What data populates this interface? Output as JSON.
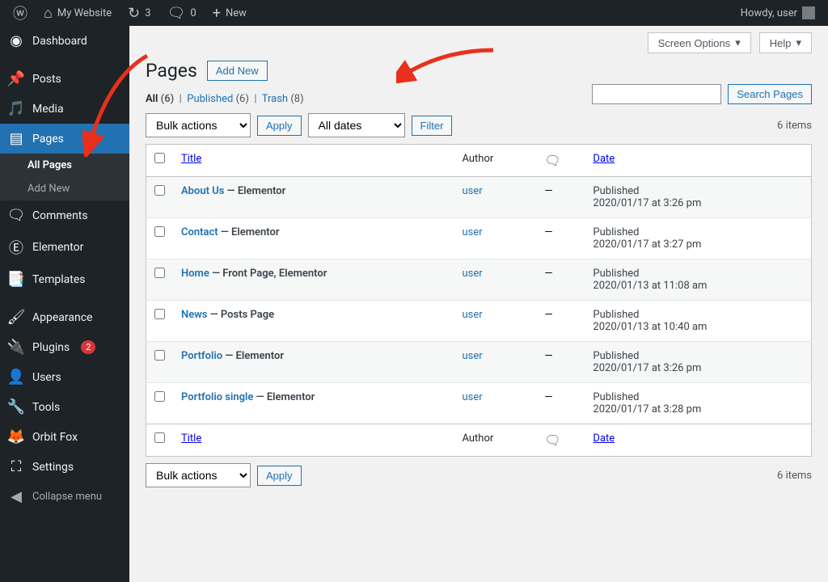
{
  "adminbar": {
    "site_name": "My Website",
    "updates_count": "3",
    "comments_count": "0",
    "new_label": "New",
    "howdy": "Howdy, user"
  },
  "sidebar": {
    "items": [
      {
        "label": "Dashboard",
        "icon": "dashboard"
      },
      {
        "label": "Posts",
        "icon": "pin"
      },
      {
        "label": "Media",
        "icon": "media"
      },
      {
        "label": "Pages",
        "icon": "pages",
        "current": true
      },
      {
        "label": "Comments",
        "icon": "comment"
      },
      {
        "label": "Elementor",
        "icon": "elementor"
      },
      {
        "label": "Templates",
        "icon": "templates"
      },
      {
        "label": "Appearance",
        "icon": "brush"
      },
      {
        "label": "Plugins",
        "icon": "plugin",
        "badge": "2"
      },
      {
        "label": "Users",
        "icon": "user"
      },
      {
        "label": "Tools",
        "icon": "wrench"
      },
      {
        "label": "Orbit Fox",
        "icon": "orbitfox"
      },
      {
        "label": "Settings",
        "icon": "settings"
      }
    ],
    "submenu": [
      {
        "label": "All Pages",
        "current": true
      },
      {
        "label": "Add New"
      }
    ],
    "collapse": "Collapse menu"
  },
  "header": {
    "screen_options": "Screen Options",
    "help": "Help",
    "page_title": "Pages",
    "add_new": "Add New"
  },
  "filters": {
    "all_label": "All",
    "all_count": "(6)",
    "published_label": "Published",
    "published_count": "(6)",
    "trash_label": "Trash",
    "trash_count": "(8)"
  },
  "search": {
    "button": "Search Pages"
  },
  "tablenav": {
    "bulk_label": "Bulk actions",
    "apply": "Apply",
    "dates_label": "All dates",
    "filter": "Filter",
    "item_count": "6 items"
  },
  "table": {
    "col_title": "Title",
    "col_author": "Author",
    "col_date": "Date",
    "rows": [
      {
        "title": "About Us",
        "state": "— Elementor",
        "author": "user",
        "comments": "—",
        "date_status": "Published",
        "date": "2020/01/17 at 3:26 pm"
      },
      {
        "title": "Contact",
        "state": "— Elementor",
        "author": "user",
        "comments": "—",
        "date_status": "Published",
        "date": "2020/01/17 at 3:27 pm"
      },
      {
        "title": "Home",
        "state": "— Front Page, Elementor",
        "author": "user",
        "comments": "—",
        "date_status": "Published",
        "date": "2020/01/13 at 11:08 am"
      },
      {
        "title": "News",
        "state": "— Posts Page",
        "author": "user",
        "comments": "—",
        "date_status": "Published",
        "date": "2020/01/13 at 10:40 am"
      },
      {
        "title": "Portfolio",
        "state": "— Elementor",
        "author": "user",
        "comments": "—",
        "date_status": "Published",
        "date": "2020/01/17 at 3:26 pm"
      },
      {
        "title": "Portfolio single",
        "state": "— Elementor",
        "author": "user",
        "comments": "—",
        "date_status": "Published",
        "date": "2020/01/17 at 3:28 pm"
      }
    ]
  }
}
